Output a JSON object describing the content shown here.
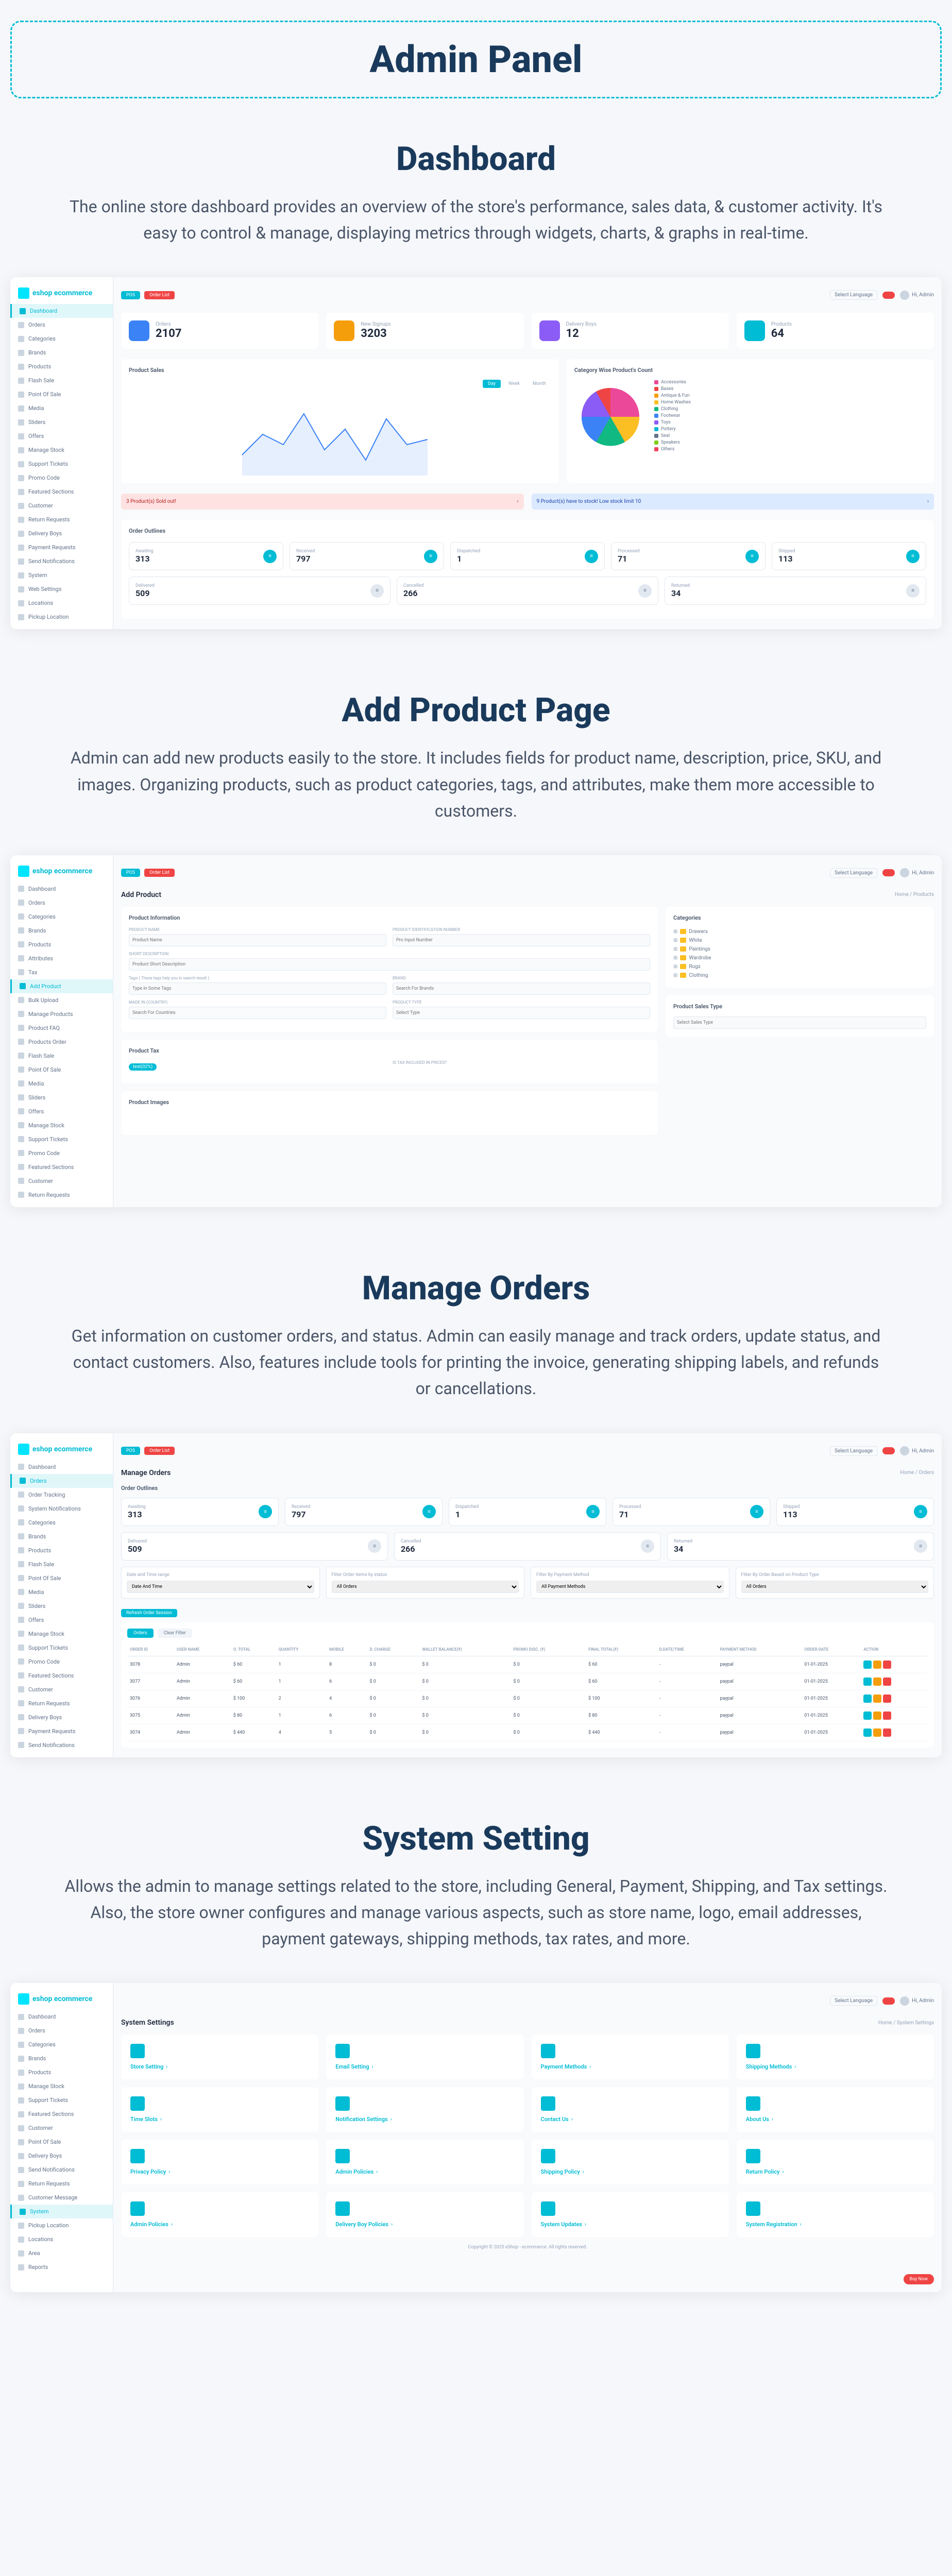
{
  "header": {
    "title": "Admin Panel"
  },
  "sections": {
    "dashboard": {
      "title": "Dashboard",
      "desc": "The online store dashboard provides an overview of the store's performance, sales data, & customer activity. It's easy to control & manage, displaying metrics through widgets, charts, & graphs in real-time."
    },
    "addproduct": {
      "title": "Add Product Page",
      "desc": "Admin can add new products easily to the store. It includes fields for product name, description, price, SKU, and images. Organizing products, such as product categories, tags, and attributes, make them more accessible to customers."
    },
    "orders": {
      "title": "Manage Orders",
      "desc": "Get information on customer orders, and status. Admin can easily manage and track orders, update status, and contact customers. Also, features include tools for printing the invoice, generating shipping labels, and refunds or cancellations."
    },
    "settings": {
      "title": "System Setting",
      "desc": "Allows the admin to manage settings related to the store, including General, Payment, Shipping, and Tax settings. Also, the store owner configures and manage various aspects, such as store name, logo, email addresses, payment gateways, shipping methods, tax rates, and more."
    }
  },
  "logo": "eshop ecommerce",
  "topbar": {
    "pill1": "POS",
    "pill2": "Order List",
    "lang": "Select Language",
    "admin": "Hi, Admin"
  },
  "sidebar": {
    "dashboard": [
      "Dashboard",
      "Orders",
      "Categories",
      "Brands",
      "Products",
      "Flash Sale",
      "Point Of Sale",
      "Media",
      "Sliders",
      "Offers",
      "Manage Stock",
      "Support Tickets",
      "Promo Code",
      "Featured Sections",
      "Customer",
      "Return Requests",
      "Delivery Boys",
      "Payment Requests",
      "Send Notifications",
      "System",
      "Web Settings",
      "Locations",
      "Pickup Location"
    ],
    "product": [
      "Dashboard",
      "Orders",
      "Categories",
      "Brands",
      "Products",
      "Attributes",
      "Tax",
      "Add Product",
      "Bulk Upload",
      "Manage Products",
      "Product FAQ",
      "Products Order",
      "Flash Sale",
      "Point Of Sale",
      "Media",
      "Sliders",
      "Offers",
      "Manage Stock",
      "Support Tickets",
      "Promo Code",
      "Featured Sections",
      "Customer",
      "Return Requests"
    ],
    "orders": [
      "Dashboard",
      "Orders",
      "Order Tracking",
      "System Notifications",
      "Categories",
      "Brands",
      "Products",
      "Flash Sale",
      "Point Of Sale",
      "Media",
      "Sliders",
      "Offers",
      "Manage Stock",
      "Support Tickets",
      "Promo Code",
      "Featured Sections",
      "Customer",
      "Return Requests",
      "Delivery Boys",
      "Payment Requests",
      "Send Notifications"
    ],
    "settings": [
      "Dashboard",
      "Orders",
      "Categories",
      "Brands",
      "Products",
      "Manage Stock",
      "Support Tickets",
      "Featured Sections",
      "Customer",
      "Point Of Sale",
      "Delivery Boys",
      "Send Notifications",
      "Return Requests",
      "Customer Message",
      "System",
      "Pickup Location",
      "Locations",
      "Area",
      "Reports"
    ]
  },
  "dashboard": {
    "stats": {
      "orders": {
        "label": "Orders",
        "value": "2107"
      },
      "signups": {
        "label": "New Signups",
        "value": "3203"
      },
      "delivery": {
        "label": "Delivery Boys",
        "value": "12"
      },
      "products": {
        "label": "Products",
        "value": "64"
      }
    },
    "chart_title": "Product Sales",
    "chart_tabs": [
      "Day",
      "Week",
      "Month"
    ],
    "pie_title": "Category Wise Product's Count",
    "pie_legend": [
      "Accessories",
      "Bases",
      "Antique & Fun",
      "Home Washes",
      "Clothing",
      "Footwear",
      "Toys",
      "Pottery",
      "Seal",
      "Speakers",
      "Others"
    ],
    "alert_red": "3 Product(s) Sold out!",
    "alert_blue": "9 Product(s) have to stock! Low stock limit 10",
    "outlines_title": "Order Outlines",
    "outlines": [
      {
        "label": "Awaiting",
        "value": "313"
      },
      {
        "label": "Received",
        "value": "797"
      },
      {
        "label": "Dispatched",
        "value": "1"
      },
      {
        "label": "Processed",
        "value": "71"
      },
      {
        "label": "Shipped",
        "value": "113"
      },
      {
        "label": "Delivered",
        "value": "509"
      },
      {
        "label": "Cancelled",
        "value": "266"
      },
      {
        "label": "Returned",
        "value": "34"
      }
    ]
  },
  "addproduct": {
    "page_title": "Add Product",
    "breadcrumb": "Home / Products",
    "info_title": "Product Information",
    "cat_title": "Categories",
    "tax_title": "Product Tax",
    "sales_title": "Product Sales Type",
    "images_title": "Product Images",
    "fields": {
      "name": "PRODUCT NAME",
      "desc": "SHORT DESCRIPTION",
      "tags": "Tags ( These tags help you in search result )",
      "ident": "PRODUCT IDENTIFICATION NUMBER",
      "country": "MADE IN (COUNTRY)",
      "type": "PRODUCT TYPE",
      "brand": "BRAND"
    },
    "placeholders": {
      "name": "Product Name",
      "desc": "Product Short Description",
      "tags": "Type in Some Tags",
      "ident": "Pro Input Number",
      "country": "Search For Countries",
      "type": "Select Type",
      "brand": "Search For Brands"
    },
    "cat_tree": [
      "Drawers",
      "White",
      "Paintings",
      "Wardrobe",
      "Rugs",
      "Clothing"
    ],
    "tax_chip": "test(02%)",
    "tax_field": "IS TAX INCLUDED IN PRICES?",
    "sales_field": "Select Sales Type"
  },
  "orders": {
    "page_title": "Manage Orders",
    "breadcrumb": "Home / Orders",
    "outlines_title": "Order Outlines",
    "outlines": [
      {
        "label": "Awaiting",
        "value": "313"
      },
      {
        "label": "Received",
        "value": "797"
      },
      {
        "label": "Dispatched",
        "value": "1"
      },
      {
        "label": "Processed",
        "value": "71"
      },
      {
        "label": "Shipped",
        "value": "113"
      },
      {
        "label": "Delivered",
        "value": "509"
      },
      {
        "label": "Cancelled",
        "value": "266"
      },
      {
        "label": "Returned",
        "value": "34"
      }
    ],
    "filters": [
      {
        "label": "Date and Time range",
        "value": "Date And Time"
      },
      {
        "label": "Filter Order items by status",
        "value": "All Orders"
      },
      {
        "label": "Filter By Payment Method",
        "value": "All Payment Methods"
      },
      {
        "label": "Filter By Order Based on Product Type",
        "value": "All Orders"
      }
    ],
    "tabs": [
      "Orders",
      "Clear Filter"
    ],
    "columns": [
      "ORDER ID",
      "USER NAME",
      "O. TOTAL",
      "QUANTITY",
      "MOBILE",
      "D. CHARGE",
      "WALLET BALANCE(₹)",
      "PROMO DISC. (₹)",
      "FINAL TOTAL(₹)",
      "D.DATE/TIME",
      "PAYMENT METHOD",
      "ORDER DATE",
      "ACTION"
    ],
    "rows": [
      [
        "3078",
        "Admin",
        "$ 60",
        "1",
        "8",
        "$ 0",
        "$ 0",
        "$ 0",
        "$ 60",
        "-",
        "paypal",
        "01-01-2025"
      ],
      [
        "3077",
        "Admin",
        "$ 60",
        "1",
        "6",
        "$ 0",
        "$ 0",
        "$ 0",
        "$ 60",
        "-",
        "paypal",
        "01-01-2025"
      ],
      [
        "3076",
        "Admin",
        "$ 100",
        "2",
        "4",
        "$ 0",
        "$ 0",
        "$ 0",
        "$ 100",
        "-",
        "paypal",
        "01-01-2025"
      ],
      [
        "3075",
        "Admin",
        "$ 80",
        "1",
        "6",
        "$ 0",
        "$ 0",
        "$ 0",
        "$ 80",
        "-",
        "paypal",
        "01-01-2025"
      ],
      [
        "3074",
        "Admin",
        "$ 440",
        "4",
        "5",
        "$ 0",
        "$ 0",
        "$ 0",
        "$ 440",
        "-",
        "paypal",
        "01-01-2025"
      ]
    ],
    "reset_btn": "Refresh Order Session"
  },
  "settings": {
    "page_title": "System Settings",
    "breadcrumb": "Home / System Settings",
    "items": [
      "Store Setting",
      "Email Setting",
      "Payment Methods",
      "Shipping Methods",
      "Time Slots",
      "Notification Settings",
      "Contact Us",
      "About Us",
      "Privacy Policy",
      "Admin Policies",
      "Shipping Policy",
      "Return Policy",
      "Admin Policies",
      "Delivery Boy Policies",
      "System Updates",
      "System Registration"
    ],
    "footer": "Copyright © 2025 eShop - ecommerce. All rights reserved.",
    "buy": "Buy Now"
  }
}
